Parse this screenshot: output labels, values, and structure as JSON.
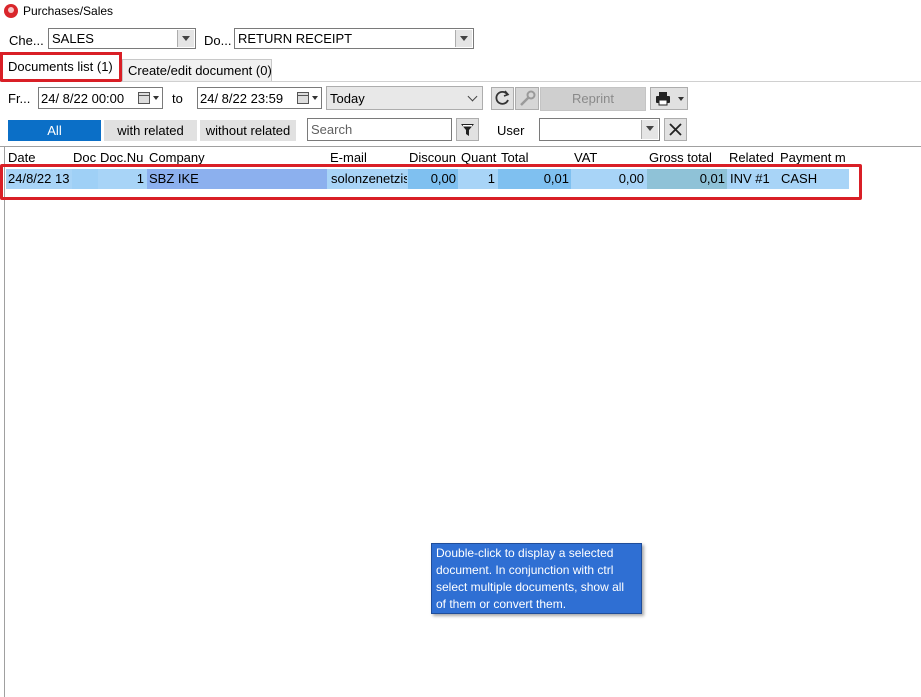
{
  "window": {
    "title": "Purchases/Sales"
  },
  "filters": {
    "check_label": "Che...",
    "check_value": "SALES",
    "doc_label": "Do...",
    "doc_value": "RETURN RECEIPT"
  },
  "tabs": [
    {
      "label": "Documents list (1)",
      "active": true
    },
    {
      "label": "Create/edit document (0)",
      "active": false
    }
  ],
  "toolbar": {
    "from_label": "Fr...",
    "from_value": "24/  8/22 00:00",
    "to_label": "to",
    "to_value": "24/  8/22 23:59",
    "period_value": "Today",
    "reprint_label": "Reprint"
  },
  "filter_buttons": {
    "all": "All",
    "with_related": "with related",
    "without_related": "without related",
    "search_placeholder": "Search",
    "user_label": "User",
    "user_value": ""
  },
  "grid": {
    "columns": [
      "Date",
      "Doc",
      "Doc.Nu",
      "Company",
      "E-mail",
      "Discoun",
      "Quant",
      "Total",
      "VAT",
      "Gross total",
      "Related",
      "Payment m"
    ],
    "rows": [
      [
        "24/8/22 13",
        "",
        "1",
        "SBZ IKE",
        "solonzenetzis",
        "0,00",
        "1",
        "0,01",
        "0,00",
        "0,01",
        "INV #1",
        "CASH"
      ]
    ]
  },
  "tooltip": {
    "text": "Double-click to display a selected document. In conjunction with ctrl select multiple documents, show all of them or convert them."
  },
  "colors": {
    "highlight_red": "#d91f26",
    "selection_blue": "#a8d4f7",
    "active_filter_blue": "#0b6fc7",
    "tooltip_blue": "#2f6fd3"
  }
}
